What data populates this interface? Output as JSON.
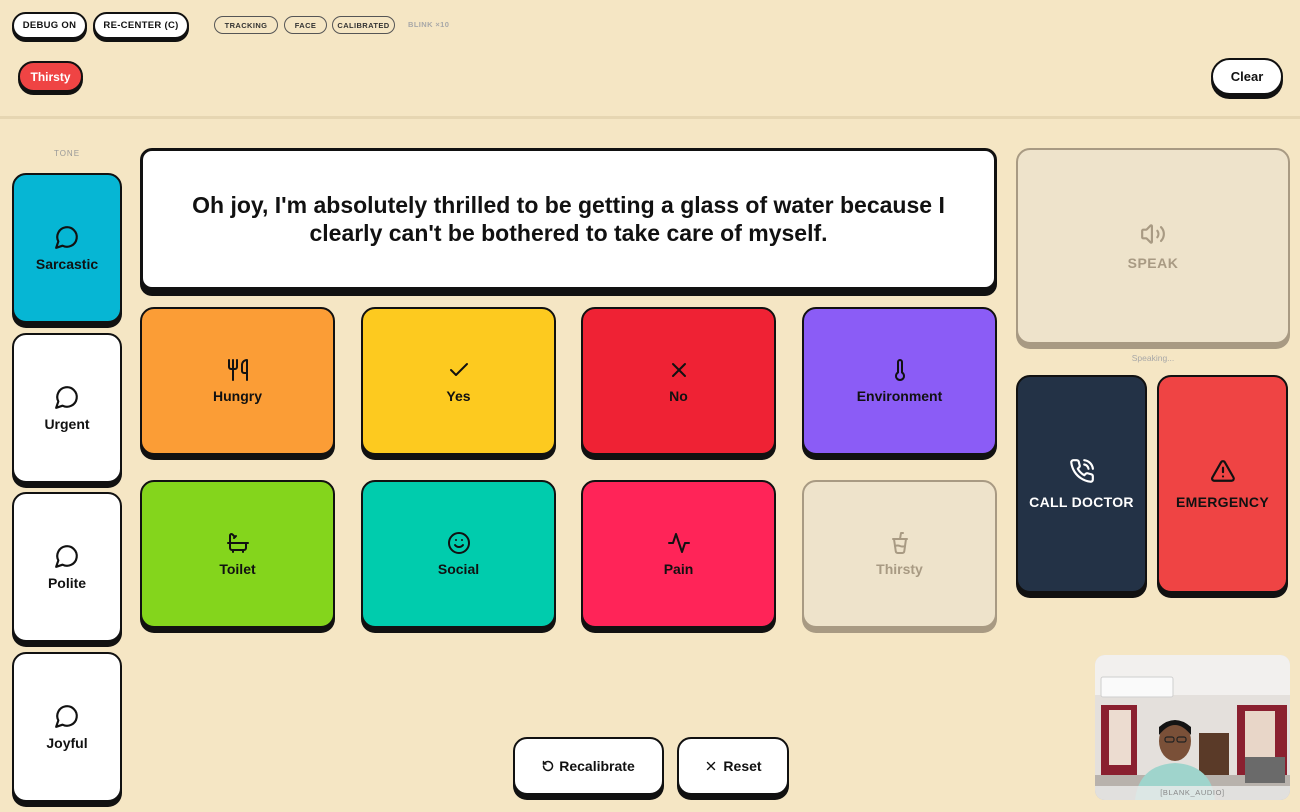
{
  "topbar": {
    "debug_label": "DEBUG ON",
    "recenter_label": "RE-CENTER (C)",
    "status": [
      "TRACKING",
      "FACE",
      "CALIBRATED"
    ],
    "blink_label": "BLINK ×10"
  },
  "selection": {
    "chip_label": "Thirsty",
    "clear_label": "Clear"
  },
  "tone": {
    "title": "TONE",
    "options": [
      {
        "label": "Sarcastic",
        "icon": "message-circle-icon",
        "active": true
      },
      {
        "label": "Urgent",
        "icon": "message-circle-icon"
      },
      {
        "label": "Polite",
        "icon": "message-circle-icon"
      },
      {
        "label": "Joyful",
        "icon": "message-circle-icon"
      }
    ]
  },
  "message": {
    "text": "Oh joy, I'm absolutely thrilled to be getting a glass of water because I clearly can't be bothered to take care of myself."
  },
  "grid": [
    {
      "label": "Hungry",
      "icon": "utensils-icon",
      "color": "#fb9d36"
    },
    {
      "label": "Yes",
      "icon": "check-icon",
      "color": "#fdca1f"
    },
    {
      "label": "No",
      "icon": "x-icon",
      "color": "#ef2234"
    },
    {
      "label": "Environment",
      "icon": "thermometer-icon",
      "color": "#8b5cf6"
    },
    {
      "label": "Toilet",
      "icon": "bath-icon",
      "color": "#84d51c"
    },
    {
      "label": "Social",
      "icon": "smile-icon",
      "color": "#00ccad"
    },
    {
      "label": "Pain",
      "icon": "activity-icon",
      "color": "#ff2458"
    },
    {
      "label": "Thirsty",
      "icon": "cup-soda-icon",
      "color": "#eee3cb",
      "disabled": true
    }
  ],
  "speak": {
    "label": "SPEAK",
    "status": "Speaking..."
  },
  "actions": {
    "call_doctor": "CALL DOCTOR",
    "call_doctor_color": "#233246",
    "emergency": "EMERGENCY",
    "emergency_color": "#ef4444"
  },
  "bottom": {
    "recalibrate": "Recalibrate",
    "reset": "Reset"
  },
  "camera": {
    "label": "[BLANK_AUDIO]"
  }
}
